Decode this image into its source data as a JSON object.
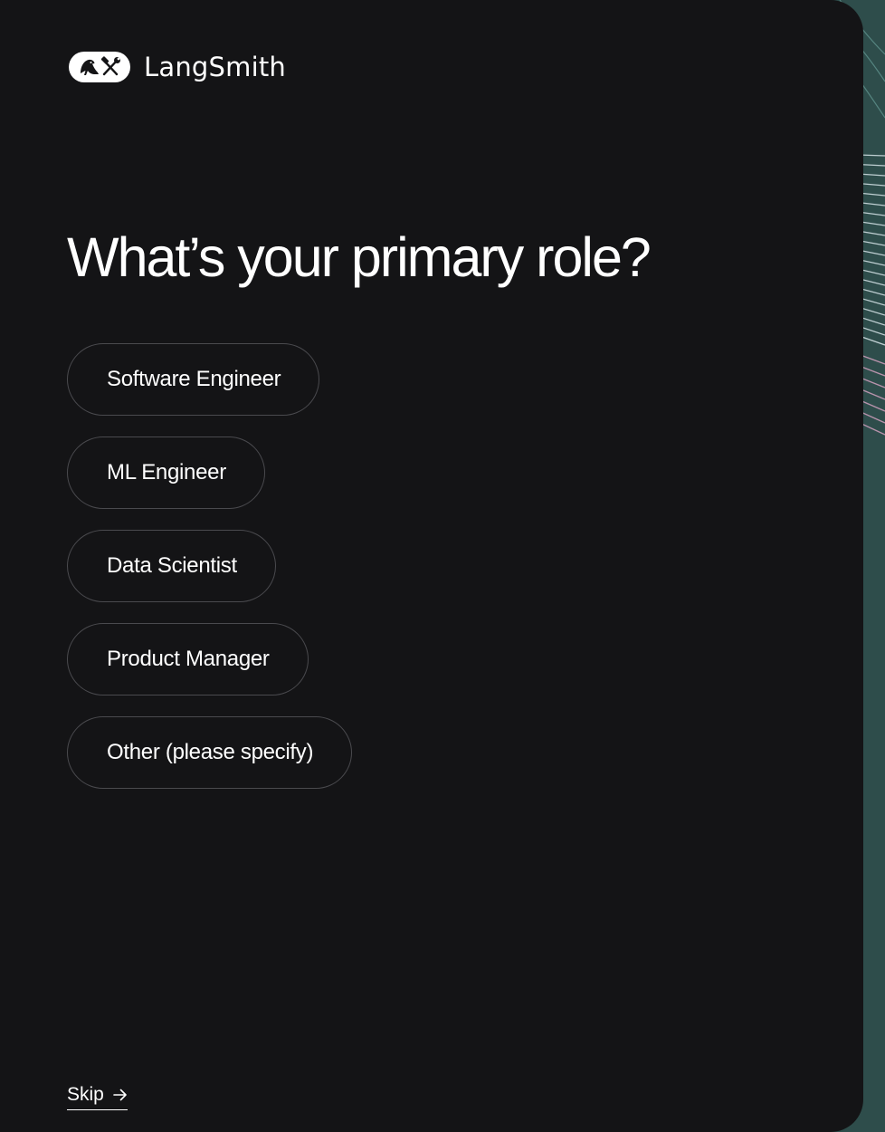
{
  "brand": {
    "name": "LangSmith",
    "logo_icon": "parrot-tools-icon"
  },
  "page": {
    "heading": "What’s your primary role?"
  },
  "options": [
    {
      "label": "Software Engineer"
    },
    {
      "label": "ML Engineer"
    },
    {
      "label": "Data Scientist"
    },
    {
      "label": "Product Manager"
    },
    {
      "label": "Other (please specify)"
    }
  ],
  "footer": {
    "skip_label": "Skip",
    "skip_icon": "arrow-right-icon"
  },
  "colors": {
    "panel_bg": "#141416",
    "text": "#ffffff",
    "option_border": "#4a4a4e",
    "accent_bg": "#2b4a48",
    "accent_pink": "#b98aa8"
  }
}
